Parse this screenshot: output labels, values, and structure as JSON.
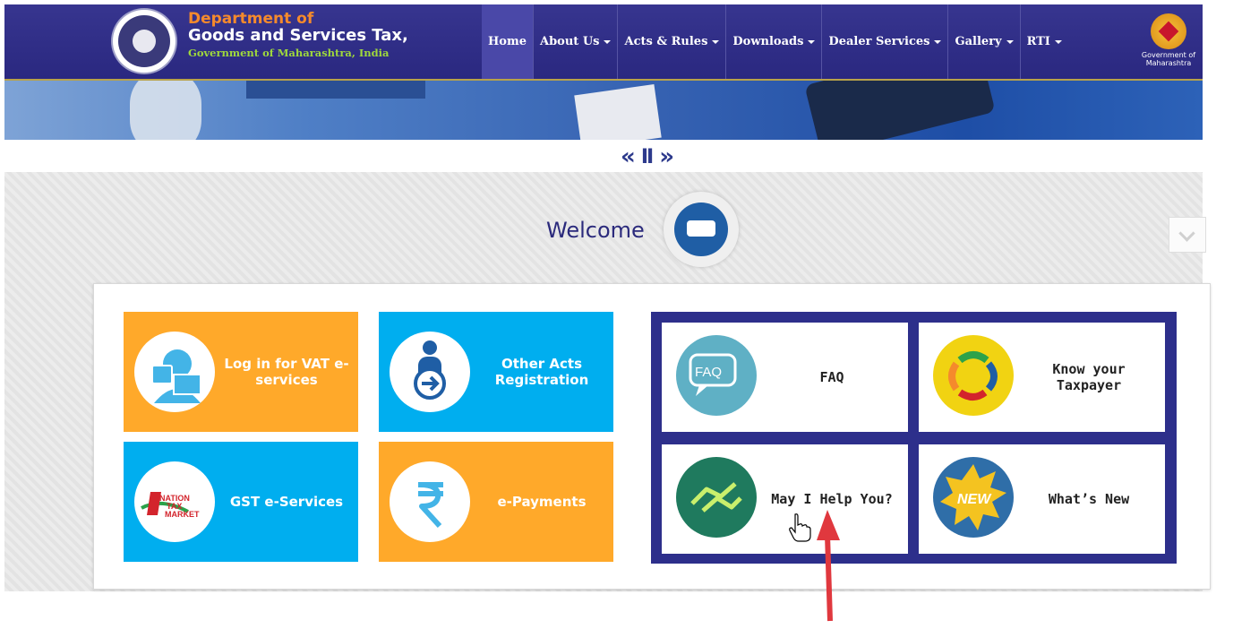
{
  "header": {
    "dept_line1": "Department of",
    "dept_line2": "Goods and Services Tax,",
    "dept_line3": "Government of Maharashtra, India",
    "gov_logo_text": "Government of Maharashtra"
  },
  "nav": {
    "items": [
      {
        "label": "Home",
        "dropdown": false,
        "active": true
      },
      {
        "label": "About Us",
        "dropdown": true
      },
      {
        "label": "Acts & Rules",
        "dropdown": true
      },
      {
        "label": "Downloads",
        "dropdown": true
      },
      {
        "label": "Dealer Services",
        "dropdown": true
      },
      {
        "label": "Gallery",
        "dropdown": true
      },
      {
        "label": "RTI",
        "dropdown": true
      }
    ]
  },
  "slider": {
    "prev": "«",
    "pause": "II",
    "next": "»"
  },
  "welcome": {
    "title": "Welcome"
  },
  "tiles": [
    {
      "label": "Log in for VAT e-services",
      "color": "#ffa92a",
      "icon": "login-icon"
    },
    {
      "label": "Other Acts Registration",
      "color": "#00aeef",
      "icon": "registration-icon"
    },
    {
      "label": "GST e-Services",
      "color": "#00aeef",
      "icon": "nation-tax-market-logo",
      "logo_text": "NATION TAX MARKET"
    },
    {
      "label": "e-Payments",
      "color": "#ffa92a",
      "icon": "rupee-icon"
    }
  ],
  "cards": [
    {
      "label": "FAQ",
      "icon": "faq-icon"
    },
    {
      "label": "Know your Taxpayer",
      "icon": "know-taxpayer-icon"
    },
    {
      "label": "May I Help You?",
      "icon": "handshake-icon"
    },
    {
      "label": "What’s New",
      "icon": "new-badge-icon"
    }
  ],
  "colors": {
    "header_bg": "#2e2c86",
    "accent_orange": "#f58a2c",
    "accent_green": "#9fd83c",
    "tile_orange": "#ffa92a",
    "tile_blue": "#00aeef",
    "cards_frame": "#2d2f8b",
    "annotation_arrow": "#e0383e"
  }
}
